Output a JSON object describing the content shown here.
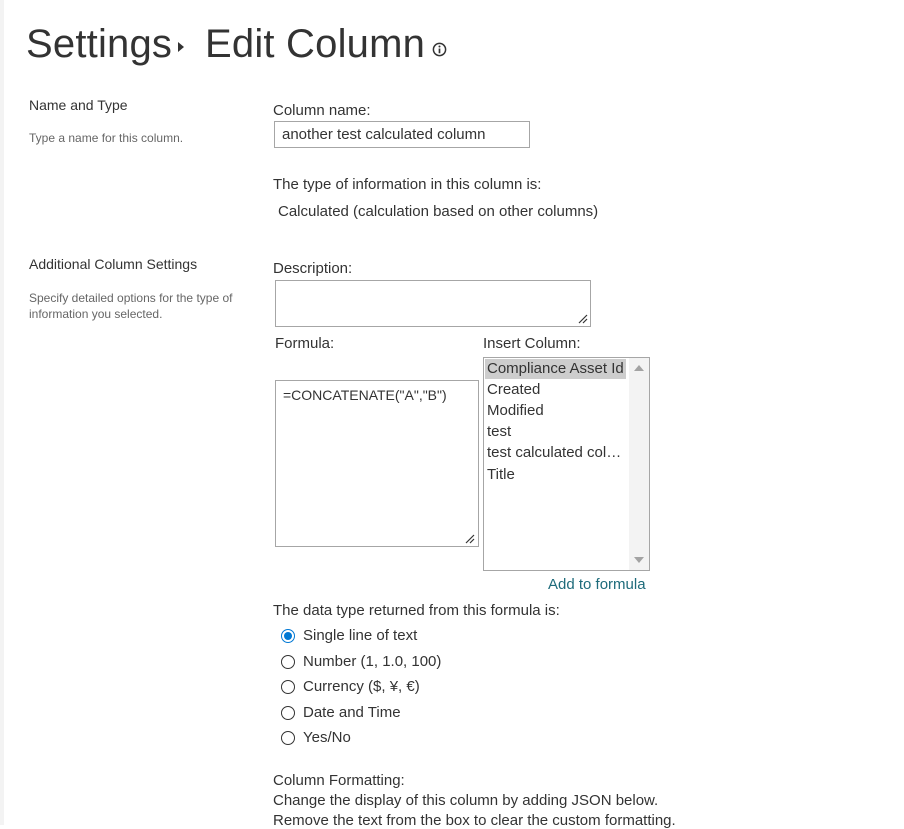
{
  "header": {
    "breadcrumb_parent": "Settings",
    "page_title": "Edit Column",
    "info_icon": "info-circle-icon"
  },
  "sections": {
    "name_and_type": {
      "title": "Name and Type",
      "description": "Type a name for this column."
    },
    "additional_settings": {
      "title": "Additional Column Settings",
      "description": "Specify detailed options for the type of information you selected."
    }
  },
  "column_name": {
    "label": "Column name:",
    "value": "another test calculated column"
  },
  "column_type": {
    "label": "The type of information in this column is:",
    "value": "Calculated (calculation based on other columns)"
  },
  "description": {
    "label": "Description:",
    "value": ""
  },
  "formula": {
    "label": "Formula:",
    "value": "=CONCATENATE(\"A\",\"B\")"
  },
  "insert_column": {
    "label": "Insert Column:",
    "options": [
      "Compliance Asset Id",
      "Created",
      "Modified",
      "test",
      "test calculated colu...",
      "Title"
    ],
    "selected": "Compliance Asset Id",
    "add_link": "Add to formula"
  },
  "data_type": {
    "label": "The data type returned from this formula is:",
    "options": [
      "Single line of text",
      "Number (1, 1.0, 100)",
      "Currency ($, ¥, €)",
      "Date and Time",
      "Yes/No"
    ],
    "selected": "Single line of text"
  },
  "column_formatting": {
    "label": "Column Formatting:",
    "line1": "Change the display of this column by adding JSON below.",
    "line2": "Remove the text from the box to clear the custom formatting."
  },
  "colors": {
    "accent": "#0078d4",
    "link": "#1e6b7b",
    "selection": "#cdcdcd"
  }
}
